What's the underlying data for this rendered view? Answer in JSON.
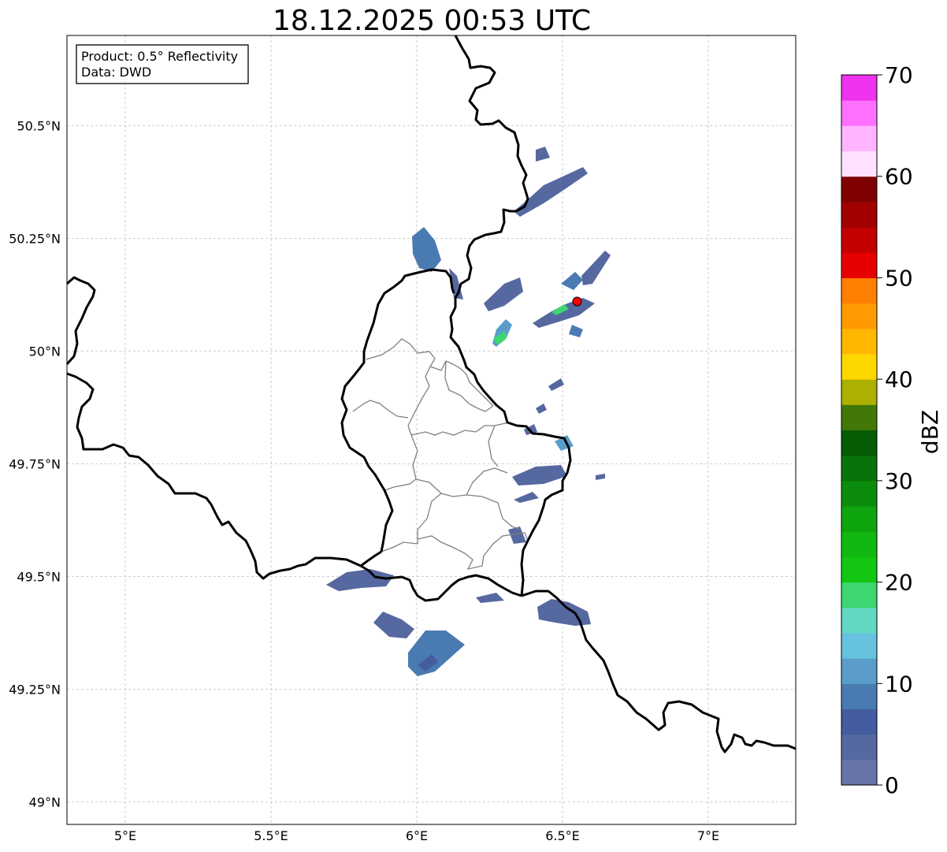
{
  "title": "18.12.2025 00:53 UTC",
  "info_box": {
    "product": "Product: 0.5° Reflectivity",
    "data": "Data: DWD"
  },
  "map": {
    "x_ticks": [
      {
        "value": 5.0,
        "label": "5°E"
      },
      {
        "value": 5.5,
        "label": "5.5°E"
      },
      {
        "value": 6.0,
        "label": "6°E"
      },
      {
        "value": 6.5,
        "label": "6.5°E"
      },
      {
        "value": 7.0,
        "label": "7°E"
      }
    ],
    "y_ticks": [
      {
        "value": 50.5,
        "label": "50.5°N"
      },
      {
        "value": 50.25,
        "label": "50.25°N"
      },
      {
        "value": 50.0,
        "label": "50°N"
      },
      {
        "value": 49.75,
        "label": "49.75°N"
      },
      {
        "value": 49.5,
        "label": "49.5°N"
      },
      {
        "value": 49.25,
        "label": "49.25°N"
      },
      {
        "value": 49.0,
        "label": "49°N"
      }
    ],
    "lon_range": [
      4.8,
      7.3
    ],
    "lat_range": [
      48.95,
      50.7
    ],
    "gridlines": true,
    "marker": {
      "lon": 6.55,
      "lat": 50.11,
      "color": "#ff0000"
    },
    "colors": {
      "country_border": "#000000",
      "district_border": "#808080",
      "grid": "#bfbfbf"
    }
  },
  "colorbar": {
    "label": "dBZ",
    "min": 0,
    "max": 70,
    "tick_labels": [
      "0",
      "10",
      "20",
      "30",
      "40",
      "50",
      "60",
      "70"
    ],
    "colors": [
      "#6674a8",
      "#5668a0",
      "#445ca0",
      "#4a7ab2",
      "#5a9dca",
      "#66c2de",
      "#62d8c2",
      "#3ed670",
      "#12c612",
      "#10b810",
      "#0ea40e",
      "#0c8c0c",
      "#097209",
      "#045c04",
      "#427808",
      "#adb000",
      "#ffd700",
      "#ffb700",
      "#ff9a00",
      "#ff7f00",
      "#e60000",
      "#c20000",
      "#a00000",
      "#7e0000",
      "#ffe0ff",
      "#ffb4ff",
      "#ff70ff",
      "#ee32ee"
    ]
  }
}
